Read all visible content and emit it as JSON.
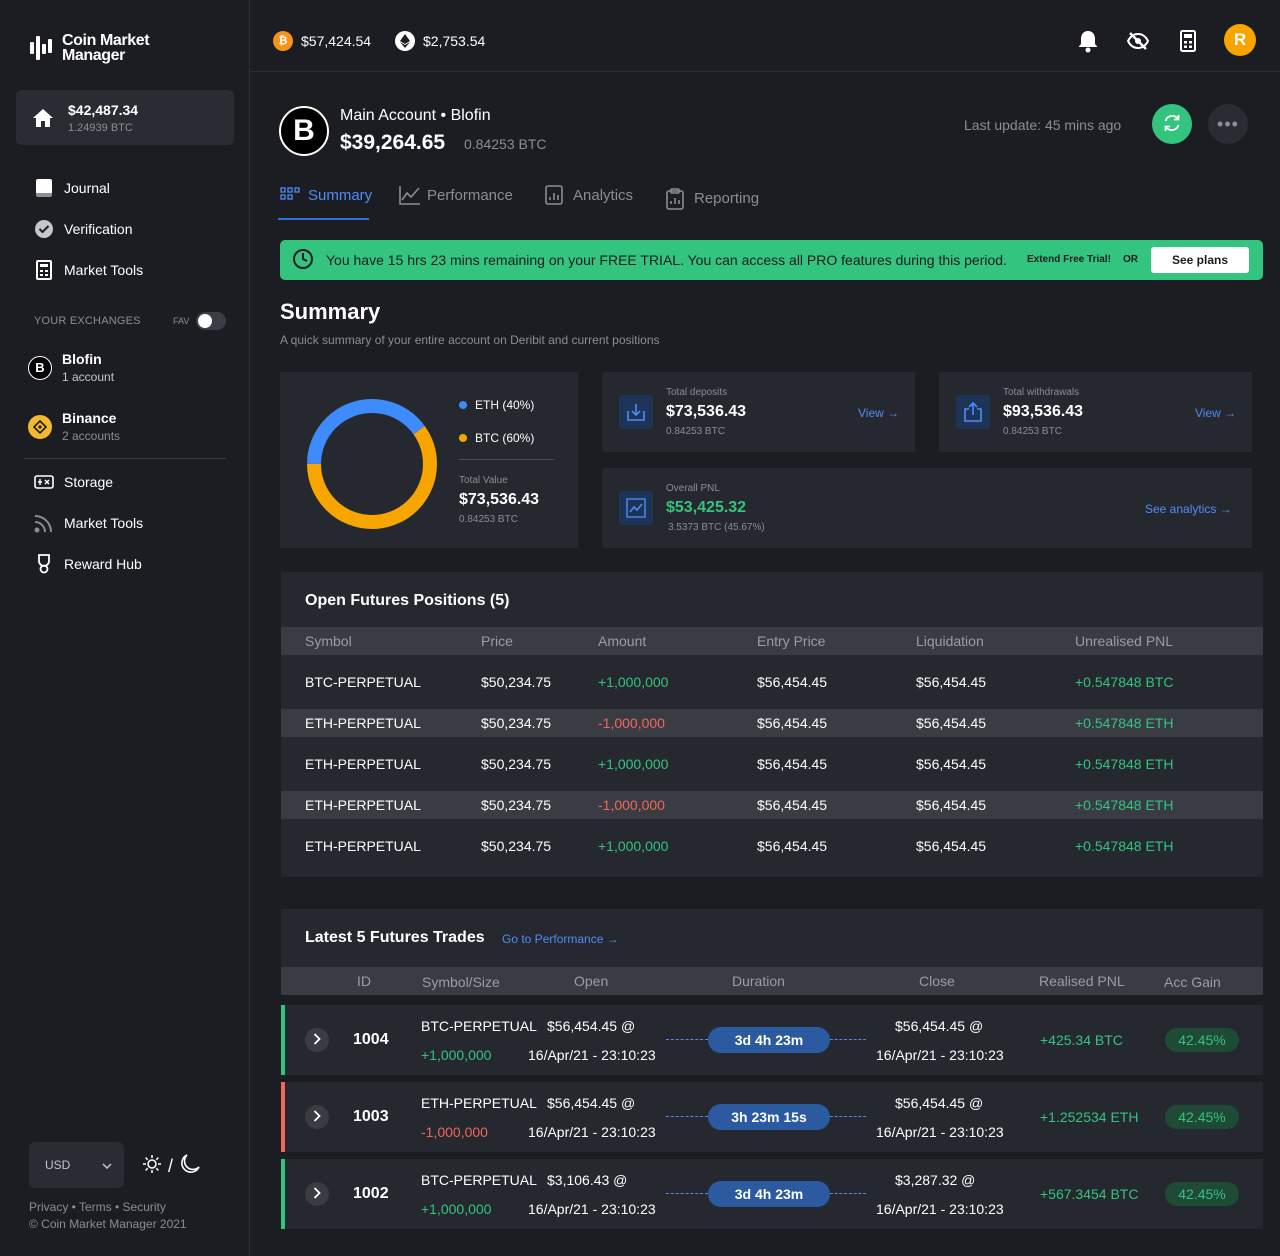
{
  "app": {
    "logo_line1": "Coin Market",
    "logo_line2": "Manager"
  },
  "sidebar": {
    "balance": {
      "amount": "$42,487.34",
      "btc": "1.24939 BTC"
    },
    "nav": [
      {
        "label": "Journal",
        "icon": "book-icon"
      },
      {
        "label": "Verification",
        "icon": "check-circle-icon"
      },
      {
        "label": "Market Tools",
        "icon": "calculator-icon"
      }
    ],
    "exchanges_label": "YOUR EXCHANGES",
    "fav_label": "FAV",
    "exchanges": [
      {
        "name": "Blofin",
        "accounts": "1 account"
      },
      {
        "name": "Binance",
        "accounts": "2 accounts"
      }
    ],
    "nav2": [
      {
        "label": "Storage",
        "icon": "storage-icon"
      },
      {
        "label": "Market Tools",
        "icon": "rss-icon"
      },
      {
        "label": "Reward Hub",
        "icon": "trophy-icon"
      }
    ],
    "currency": "USD",
    "footer": {
      "privacy": "Privacy",
      "terms": "Terms",
      "security": "Security",
      "copyright": "© Coin Market Manager 2021"
    }
  },
  "topbar": {
    "btc_price": "$57,424.54",
    "eth_price": "$2,753.54",
    "avatar_letter": "R"
  },
  "account": {
    "title": "Main Account",
    "exchange": "Blofin",
    "amount": "$39,264.65",
    "btc": "0.84253 BTC",
    "last_update": "Last update: 45 mins ago"
  },
  "tabs": [
    {
      "label": "Summary",
      "active": true
    },
    {
      "label": "Performance"
    },
    {
      "label": "Analytics"
    },
    {
      "label": "Reporting"
    }
  ],
  "trial": {
    "message": "You have 15 hrs 23 mins remaining on your FREE TRIAL. You can access all PRO features during this period.",
    "extend": "Extend Free Trial!",
    "or": "OR",
    "see_plans": "See plans"
  },
  "summary": {
    "title": "Summary",
    "subtitle": "A quick summary of your entire account on Deribit and current positions",
    "allocation": {
      "eth_label": "ETH (40%)",
      "btc_label": "BTC (60%)",
      "eth_pct": 40,
      "btc_pct": 60,
      "eth_color": "#3d8bfd",
      "btc_color": "#f7a600",
      "total_label": "Total Value",
      "total_value": "$73,536.43",
      "total_btc": "0.84253 BTC"
    },
    "deposits": {
      "label": "Total deposits",
      "value": "$73,536.43",
      "btc": "0.84253 BTC",
      "link": "View →"
    },
    "withdrawals": {
      "label": "Total withdrawals",
      "value": "$93,536.43",
      "btc": "0.84253 BTC",
      "link": "View →"
    },
    "pnl": {
      "label": "Overall PNL",
      "value": "$53,425.32",
      "btc": "3.5373 BTC (45.67%)",
      "link": "See analytics →"
    }
  },
  "positions": {
    "title": "Open Futures Positions (5)",
    "headers": [
      "Symbol",
      "Price",
      "Amount",
      "Entry Price",
      "Liquidation",
      "Unrealised PNL"
    ],
    "rows": [
      {
        "symbol": "BTC-PERPETUAL",
        "price": "$50,234.75",
        "amount": "+1,000,000",
        "dir": "green",
        "entry": "$56,454.45",
        "liq": "$56,454.45",
        "pnl": "+0.547848 BTC"
      },
      {
        "symbol": "ETH-PERPETUAL",
        "price": "$50,234.75",
        "amount": "-1,000,000",
        "dir": "red",
        "entry": "$56,454.45",
        "liq": "$56,454.45",
        "pnl": "+0.547848 ETH"
      },
      {
        "symbol": "ETH-PERPETUAL",
        "price": "$50,234.75",
        "amount": "+1,000,000",
        "dir": "green",
        "entry": "$56,454.45",
        "liq": "$56,454.45",
        "pnl": "+0.547848 ETH"
      },
      {
        "symbol": "ETH-PERPETUAL",
        "price": "$50,234.75",
        "amount": "-1,000,000",
        "dir": "red",
        "entry": "$56,454.45",
        "liq": "$56,454.45",
        "pnl": "+0.547848 ETH"
      },
      {
        "symbol": "ETH-PERPETUAL",
        "price": "$50,234.75",
        "amount": "+1,000,000",
        "dir": "green",
        "entry": "$56,454.45",
        "liq": "$56,454.45",
        "pnl": "+0.547848 ETH"
      }
    ]
  },
  "trades": {
    "title": "Latest 5 Futures Trades",
    "link": "Go to Performance →",
    "headers": [
      "ID",
      "Symbol/Size",
      "Open",
      "Duration",
      "Close",
      "Realised PNL",
      "Acc Gain"
    ],
    "rows": [
      {
        "id": "1004",
        "symbol": "BTC-PERPETUAL",
        "size": "+1,000,000",
        "dir": "green",
        "open_price": "$56,454.45 @",
        "open_time": "16/Apr/21 - 23:10:23",
        "duration": "3d 4h 23m",
        "close_price": "$56,454.45 @",
        "close_time": "16/Apr/21 - 23:10:23",
        "pnl": "+425.34 BTC",
        "gain": "42.45%"
      },
      {
        "id": "1003",
        "symbol": "ETH-PERPETUAL",
        "size": "-1,000,000",
        "dir": "red",
        "open_price": "$56,454.45 @",
        "open_time": "16/Apr/21 - 23:10:23",
        "duration": "3h 23m 15s",
        "close_price": "$56,454.45 @",
        "close_time": "16/Apr/21 - 23:10:23",
        "pnl": "+1.252534 ETH",
        "gain": "42.45%"
      },
      {
        "id": "1002",
        "symbol": "BTC-PERPETUAL",
        "size": "+1,000,000",
        "dir": "green",
        "open_price": "$3,106.43 @",
        "open_time": "16/Apr/21 - 23:10:23",
        "duration": "3d 4h 23m",
        "close_price": "$3,287.32 @",
        "close_time": "16/Apr/21 - 23:10:23",
        "pnl": "+567.3454 BTC",
        "gain": "42.45%"
      }
    ]
  },
  "colors": {
    "accent": "#4f8cf7",
    "green": "#33c47f",
    "red": "#f0675b",
    "panel": "#26282f"
  }
}
